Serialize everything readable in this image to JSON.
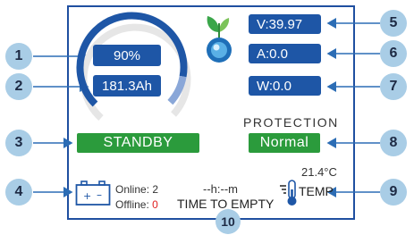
{
  "gauge": {
    "percent_label": "90%",
    "capacity_label": "181.3Ah",
    "fill_fraction": 0.9
  },
  "readouts": {
    "voltage": "V:39.97",
    "current": "A:0.0",
    "power": "W:0.0"
  },
  "status": {
    "state_label": "STANDBY",
    "protection_heading": "PROTECTION",
    "protection_value": "Normal"
  },
  "battery_info": {
    "online_label": "Online: 2",
    "offline_prefix": "Offline:",
    "offline_value": "0"
  },
  "time": {
    "value": "--h:--m",
    "label": "TIME TO EMPTY"
  },
  "temperature": {
    "value": "21.4°C",
    "label": "TEMP"
  },
  "callouts": [
    "1",
    "2",
    "3",
    "4",
    "5",
    "6",
    "7",
    "8",
    "9",
    "10"
  ],
  "colors": {
    "frame": "#1f4fa0",
    "accent_blue": "#1e56a6",
    "status_green": "#2b9b3c",
    "offline_red": "#e02020",
    "callout": "#a9cde6"
  }
}
